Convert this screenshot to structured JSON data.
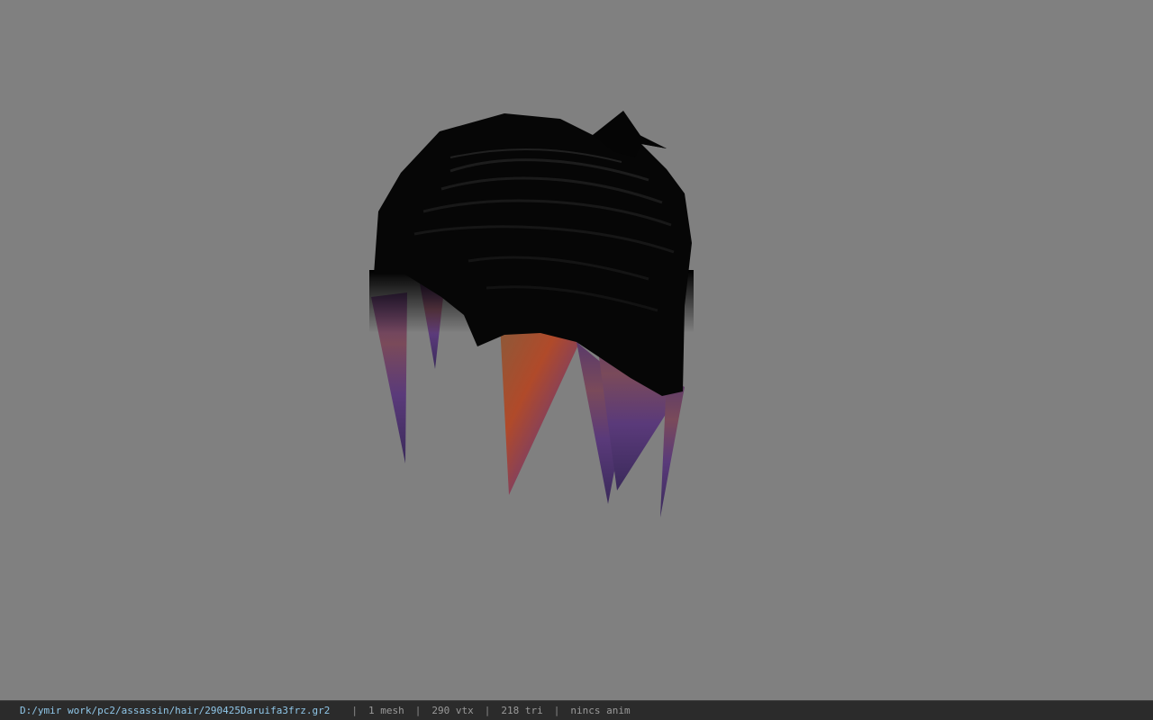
{
  "status": {
    "file_path": "D:/ymir work/pc2/assassin/hair/290425Daruifa3frz.gr2",
    "separator": "|",
    "mesh_count": "1 mesh",
    "vertex_count": "290 vtx",
    "triangle_count": "218 tri",
    "anim_status": "nincs anim"
  },
  "colors": {
    "viewport_background": "#808080",
    "statusbar_background": "#2b2b2b",
    "path_text": "#8fc6e8",
    "info_text": "#9a9a9a"
  }
}
